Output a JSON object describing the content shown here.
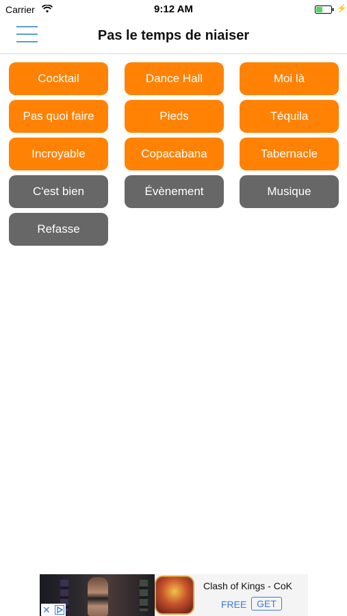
{
  "status_bar": {
    "carrier": "Carrier",
    "time": "9:12 AM"
  },
  "nav": {
    "title": "Pas le temps de niaiser",
    "menu_icon": "hamburger-menu-icon"
  },
  "colors": {
    "accent_orange": "#ff8205",
    "button_grey": "#676767",
    "menu_blue": "#5b9ad7"
  },
  "buttons": {
    "b0": "Cocktail",
    "b1": "Dance Hall",
    "b2": "Moi là",
    "b3": "Pas quoi faire",
    "b4": "Pieds",
    "b5": "Téquila",
    "b6": "Incroyable",
    "b7": "Copacabana",
    "b8": "Tabernacle",
    "b9": "C'est bien",
    "b10": "Évènement",
    "b11": "Musique",
    "b12": "Refasse"
  },
  "ad": {
    "app_name": "Clash of Kings - CoK",
    "price": "FREE",
    "cta": "GET"
  }
}
